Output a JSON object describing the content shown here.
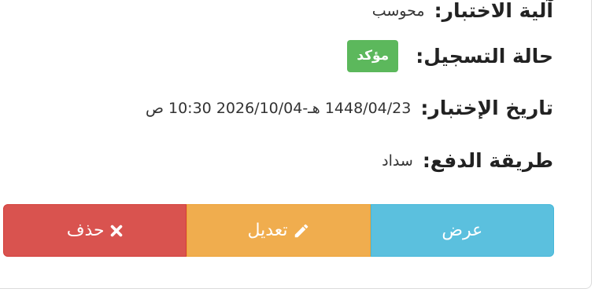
{
  "details": {
    "exam_mechanism": {
      "label": "آلية الاختبار:",
      "value": "محوسب"
    },
    "registration_status": {
      "label": "حالة التسجيل:",
      "badge": "مؤكد"
    },
    "exam_date": {
      "label": "تاريخ الإختبار:",
      "value": "1448/04/23 هـ-2026/10/04 10:30 ص"
    },
    "payment_method": {
      "label": "طريقة الدفع:",
      "value": "سداد"
    }
  },
  "actions": {
    "view_label": "عرض",
    "edit_label": "تعديل",
    "delete_label": "حذف",
    "edit_icon": "pencil-icon",
    "delete_icon": "close-icon"
  },
  "colors": {
    "view": "#5bc0de",
    "edit": "#f0ad4e",
    "delete": "#d9534f",
    "badge": "#5cb85c"
  }
}
